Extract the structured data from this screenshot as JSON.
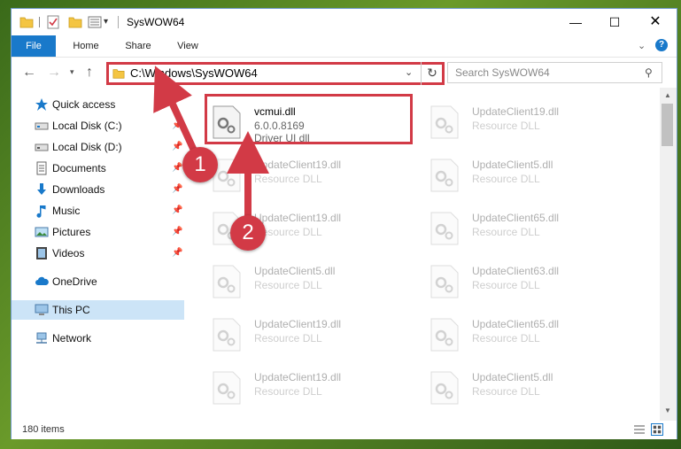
{
  "window": {
    "title": "SysWOW64"
  },
  "ribbon": {
    "tabs": [
      "File",
      "Home",
      "Share",
      "View"
    ]
  },
  "address": {
    "path": "C:\\Windows\\SysWOW64"
  },
  "search": {
    "placeholder": "Search SysWOW64"
  },
  "sidebar": {
    "items": [
      {
        "label": "Quick access",
        "icon": "star-icon",
        "pinned": false
      },
      {
        "label": "Local Disk (C:)",
        "icon": "drive-icon",
        "pinned": true
      },
      {
        "label": "Local Disk (D:)",
        "icon": "drive-icon",
        "pinned": true
      },
      {
        "label": "Documents",
        "icon": "documents-icon",
        "pinned": true
      },
      {
        "label": "Downloads",
        "icon": "download-icon",
        "pinned": true
      },
      {
        "label": "Music",
        "icon": "music-icon",
        "pinned": true
      },
      {
        "label": "Pictures",
        "icon": "pictures-icon",
        "pinned": true
      },
      {
        "label": "Videos",
        "icon": "videos-icon",
        "pinned": true
      },
      {
        "label": "OneDrive",
        "icon": "cloud-icon",
        "pinned": false
      },
      {
        "label": "This PC",
        "icon": "computer-icon",
        "pinned": false
      },
      {
        "label": "Network",
        "icon": "network-icon",
        "pinned": false
      }
    ]
  },
  "files": {
    "highlighted": {
      "name": "vcmui.dll",
      "version": "6.0.0.8169",
      "description": "Driver UI dll"
    },
    "left_column": [
      {
        "name": "UpdateClient19.dll",
        "type": "Resource DLL"
      },
      {
        "name": "UpdateClient19.dll",
        "type": "Resource DLL"
      },
      {
        "name": "UpdateClient5.dll",
        "type": "Resource DLL"
      },
      {
        "name": "UpdateClient19.dll",
        "type": "Resource DLL"
      },
      {
        "name": "UpdateClient19.dll",
        "type": "Resource DLL"
      }
    ],
    "right_column": [
      {
        "name": "UpdateClient19.dll",
        "type": "Resource DLL"
      },
      {
        "name": "UpdateClient5.dll",
        "type": "Resource DLL"
      },
      {
        "name": "UpdateClient65.dll",
        "type": "Resource DLL"
      },
      {
        "name": "UpdateClient63.dll",
        "type": "Resource DLL"
      },
      {
        "name": "UpdateClient65.dll",
        "type": "Resource DLL"
      },
      {
        "name": "UpdateClient5.dll",
        "type": "Resource DLL"
      }
    ]
  },
  "status": {
    "item_count": "180 items"
  },
  "annotations": {
    "step1": "1",
    "step2": "2"
  },
  "colors": {
    "accent": "#1979ca",
    "annotation": "#d23a46",
    "selection": "#cce4f7"
  }
}
